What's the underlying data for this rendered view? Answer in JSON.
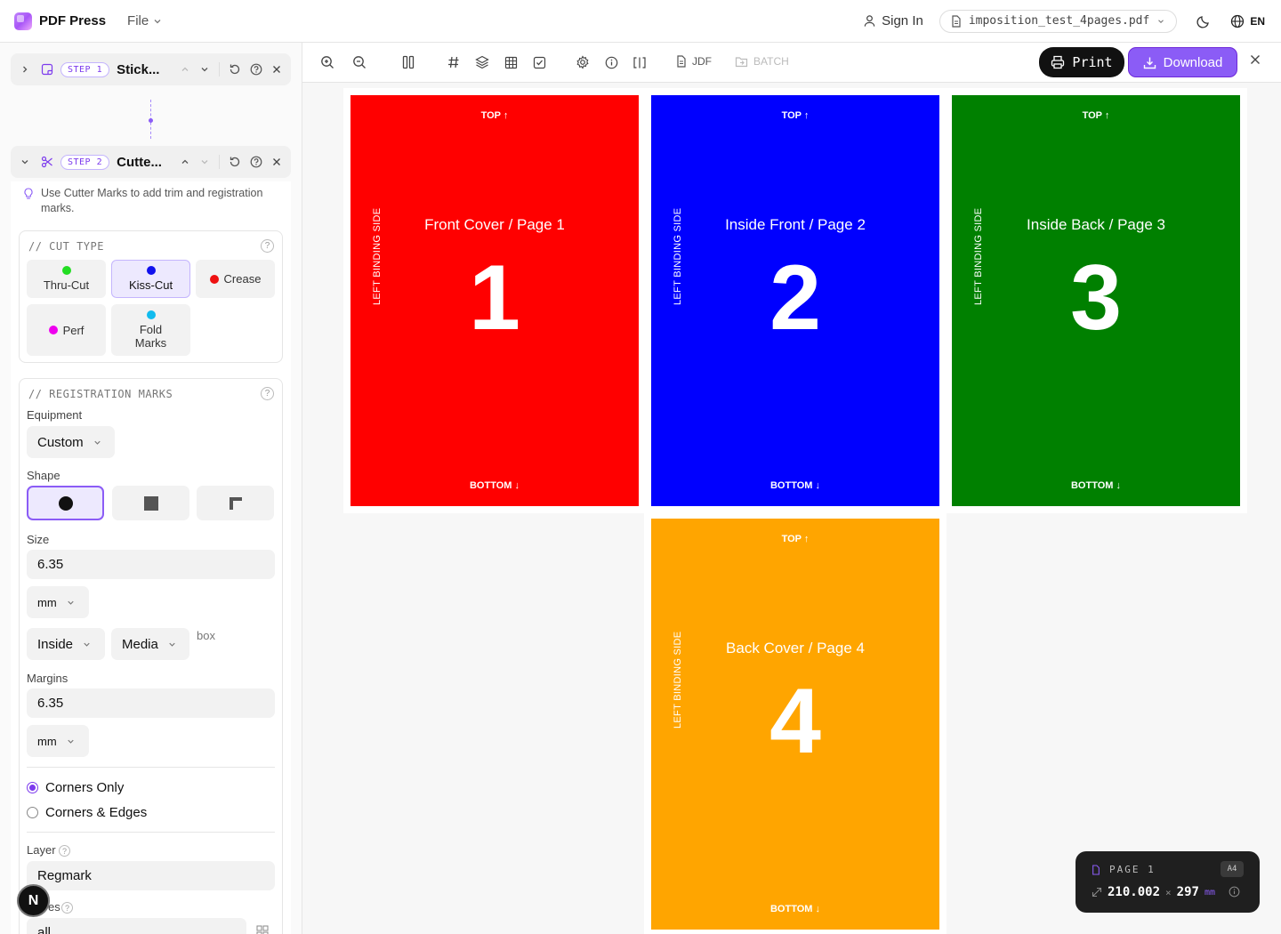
{
  "app": {
    "name": "PDF Press",
    "file_menu": "File"
  },
  "header": {
    "sign_in": "Sign In",
    "file_name": "imposition_test_4pages.pdf",
    "language": "EN"
  },
  "steps": [
    {
      "badge": "STEP 1",
      "title": "Stick..."
    },
    {
      "badge": "STEP 2",
      "title": "Cutte..."
    }
  ],
  "cutter": {
    "hint": "Use Cutter Marks to add trim and registration marks.",
    "cut_type_title": "// CUT TYPE",
    "cut_types": [
      {
        "label": "Thru-Cut",
        "color": "#22dd22"
      },
      {
        "label": "Kiss-Cut",
        "color": "#1010ee"
      },
      {
        "label": "Crease",
        "color": "#ee1111"
      },
      {
        "label": "Perf",
        "color": "#ee00ee"
      },
      {
        "label": "Fold Marks",
        "color": "#11bbee"
      }
    ],
    "reg_title": "// REGISTRATION MARKS",
    "equipment_label": "Equipment",
    "equipment_value": "Custom",
    "shape_label": "Shape",
    "size_label": "Size",
    "size_value": "6.35",
    "size_unit": "mm",
    "position_value": "Inside",
    "box_value": "Media",
    "box_suffix": "box",
    "margins_label": "Margins",
    "margins_value": "6.35",
    "margins_unit": "mm",
    "corners_only": "Corners Only",
    "corners_edges": "Corners & Edges",
    "layer_label": "Layer",
    "layer_value": "Regmark",
    "pages_label_partial": "es",
    "pages_value_partial": "all"
  },
  "toolbar": {
    "jdf": "JDF",
    "batch": "BATCH",
    "print": "Print",
    "download": "Download"
  },
  "pages": [
    {
      "top": "TOP ↑",
      "bottom": "BOTTOM ↓",
      "title": "Front Cover / Page 1",
      "number": "1",
      "side": "LEFT BINDING SIDE",
      "color": "#ff0000"
    },
    {
      "top": "TOP ↑",
      "bottom": "BOTTOM ↓",
      "title": "Inside Front / Page 2",
      "number": "2",
      "side": "LEFT BINDING SIDE",
      "color": "#0000ff"
    },
    {
      "top": "TOP ↑",
      "bottom": "BOTTOM ↓",
      "title": "Inside Back / Page 3",
      "number": "3",
      "side": "LEFT BINDING SIDE",
      "color": "#008000"
    },
    {
      "top": "TOP ↑",
      "bottom": "BOTTOM ↓",
      "title": "Back Cover / Page 4",
      "number": "4",
      "side": "LEFT BINDING SIDE",
      "color": "#ffa500"
    }
  ],
  "page_info": {
    "label": "PAGE 1",
    "size": "A4",
    "width": "210.002",
    "x": "×",
    "height": "297",
    "unit": "mm"
  },
  "next_badge": "N"
}
